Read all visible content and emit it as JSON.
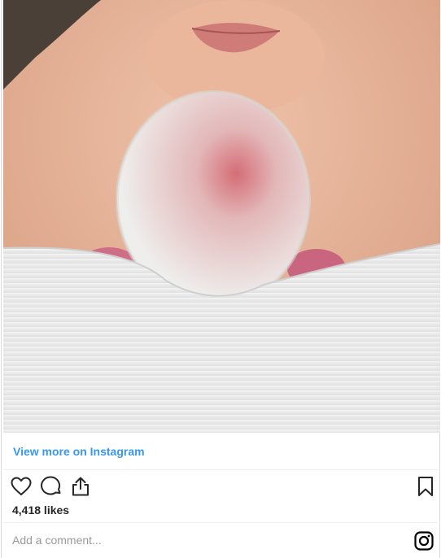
{
  "post": {
    "image_alt": "Newborn baby on mother's chest wrapped in white blanket",
    "view_more_label": "View more on Instagram",
    "likes": "4,418 likes",
    "comment_placeholder": "Add a comment..."
  },
  "actions": {
    "like_icon": "heart-outline",
    "comment_icon": "speech-bubble",
    "share_icon": "share-upload",
    "save_icon": "bookmark-outline",
    "brand_icon": "instagram-logo"
  },
  "colors": {
    "link": "#3897f0",
    "text": "#262626",
    "placeholder": "#999999",
    "divider": "#efefef"
  }
}
